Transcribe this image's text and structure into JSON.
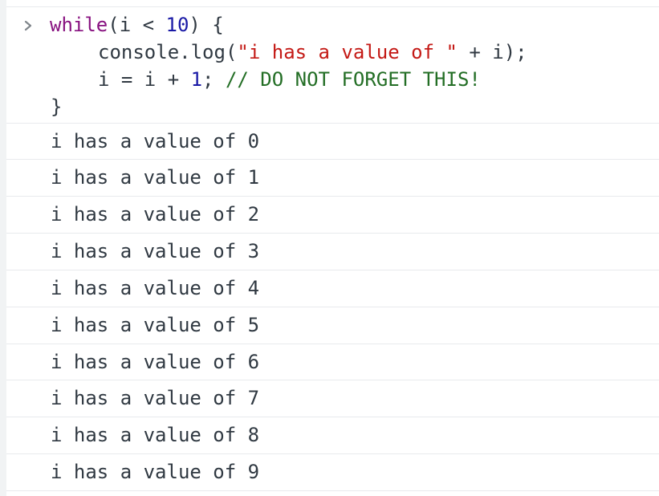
{
  "input": {
    "prompt_icon": "chevron-right-icon",
    "line1": {
      "kw": "while",
      "open": "(i < ",
      "num": "10",
      "close": ") {"
    },
    "line2": {
      "fn": "console.log(",
      "str": "\"i has a value of \"",
      "rest": " + i);"
    },
    "line3": {
      "code_a": "i = i + ",
      "num": "1",
      "code_b": "; ",
      "comment": "// DO NOT FORGET THIS!"
    },
    "line4": "}"
  },
  "logs": [
    "i has a value of 0",
    "i has a value of 1",
    "i has a value of 2",
    "i has a value of 3",
    "i has a value of 4",
    "i has a value of 5",
    "i has a value of 6",
    "i has a value of 7",
    "i has a value of 8",
    "i has a value of 9"
  ],
  "colors": {
    "keyword": "#881280",
    "number": "#1a1aa6",
    "string": "#c41a16",
    "comment": "#236e25",
    "text": "#303942"
  }
}
